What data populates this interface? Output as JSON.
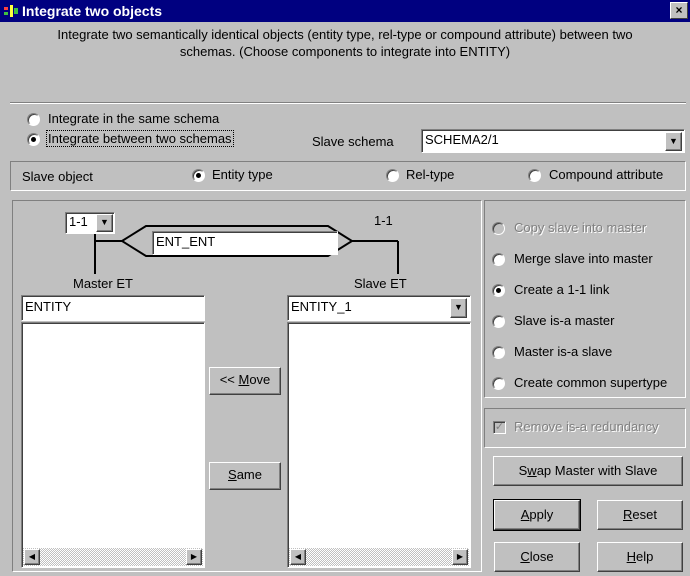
{
  "window": {
    "title": "Integrate two objects",
    "close_glyph": "×",
    "description_line1": "Integrate two semantically identical objects (entity type, rel-type or compound attribute) between two",
    "description_line2": "schemas. (Choose components to integrate into ENTITY)"
  },
  "scope": {
    "same_schema_label": "Integrate in the same schema",
    "between_schemas_label": "Integrate between two schemas",
    "selected": "between_schemas"
  },
  "slave_schema": {
    "label": "Slave schema",
    "value": "SCHEMA2/1"
  },
  "slave_object": {
    "label": "Slave object",
    "options": [
      "Entity type",
      "Rel-type",
      "Compound attribute"
    ],
    "selected": "Entity type"
  },
  "relationship": {
    "master_cardinality": "1-1",
    "slave_cardinality": "1-1",
    "name": "ENT_ENT"
  },
  "master": {
    "label": "Master ET",
    "value": "ENTITY"
  },
  "slave": {
    "label": "Slave ET",
    "value": "ENTITY_1"
  },
  "middle_buttons": {
    "move": "<< Move",
    "same": "Same"
  },
  "actions": {
    "options": [
      {
        "label": "Copy slave into master",
        "enabled": false,
        "checked": false
      },
      {
        "label": "Merge slave into master",
        "enabled": true,
        "checked": false
      },
      {
        "label": "Create a 1-1 link",
        "enabled": true,
        "checked": true
      },
      {
        "label": "Slave is-a master",
        "enabled": true,
        "checked": false
      },
      {
        "label": "Master is-a slave",
        "enabled": true,
        "checked": false
      },
      {
        "label": "Create common supertype",
        "enabled": true,
        "checked": false
      }
    ],
    "remove_redundancy_label": "Remove is-a redundancy",
    "remove_redundancy_checked": true
  },
  "buttons": {
    "swap": "Swap Master with Slave",
    "apply": "Apply",
    "reset": "Reset",
    "close": "Close",
    "help": "Help"
  },
  "colors": {
    "titlebar": "#000080",
    "face": "#c0c0c0"
  }
}
